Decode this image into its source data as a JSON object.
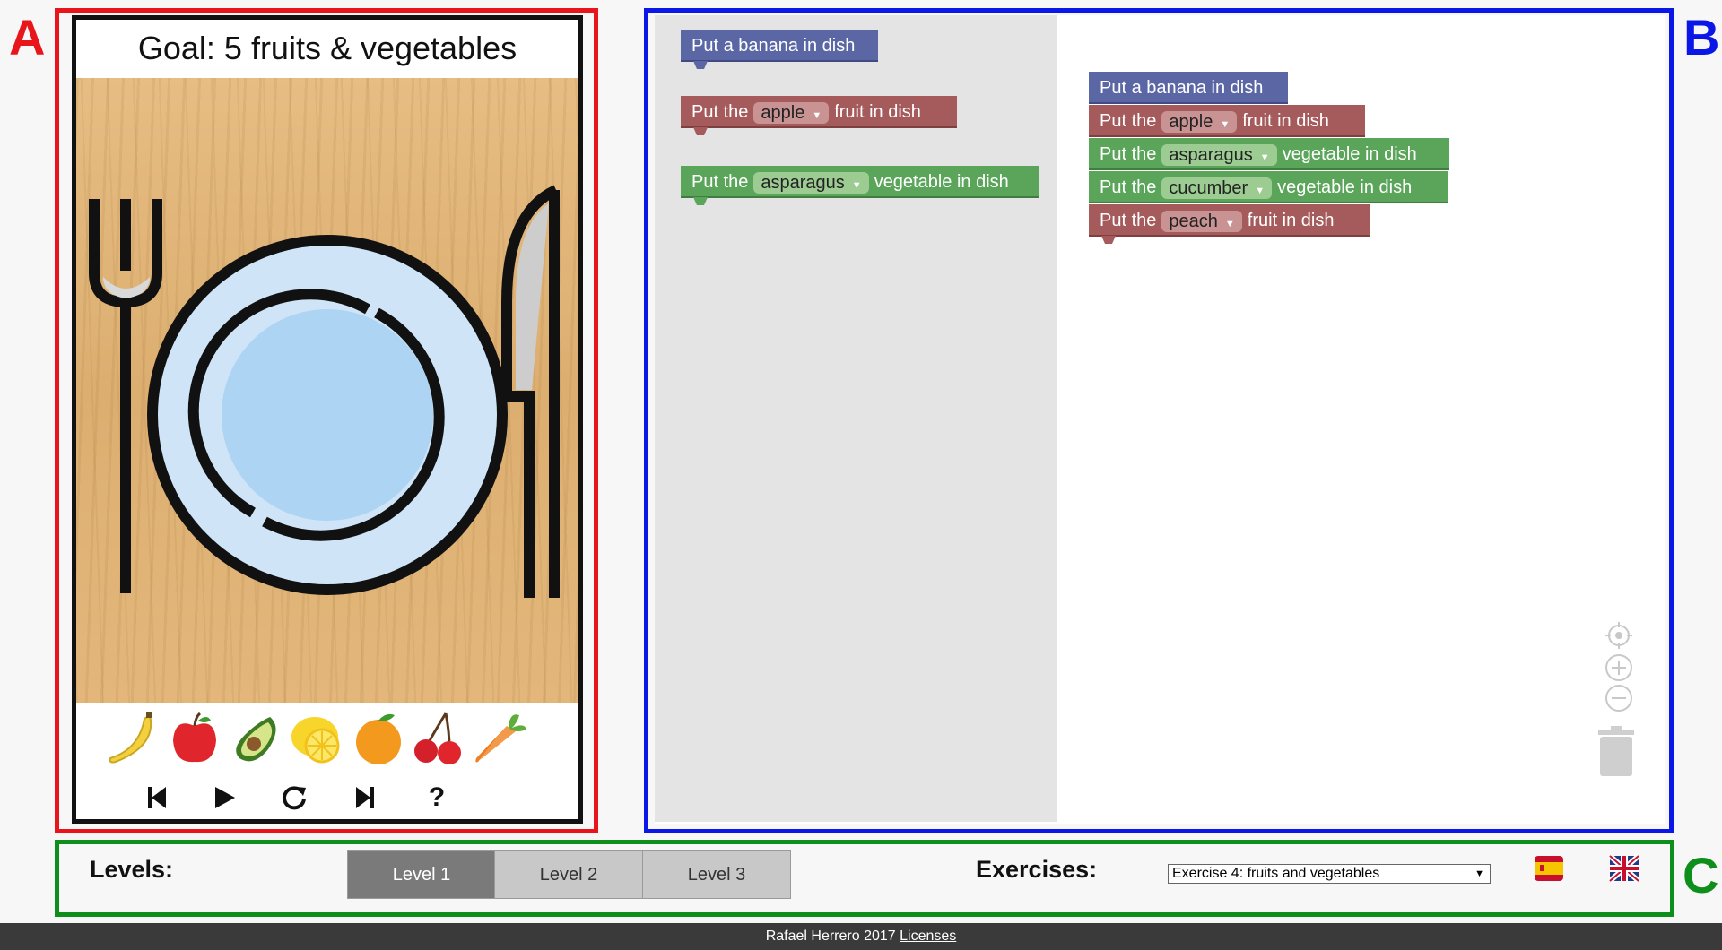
{
  "annotations": {
    "a": "A",
    "b": "B",
    "c": "C"
  },
  "game": {
    "goal": "Goal: 5 fruits & vegetables",
    "fruits": [
      "banana-icon",
      "apple-icon",
      "avocado-icon",
      "lemon-icon",
      "orange-icon",
      "cherry-icon",
      "carrot-icon"
    ],
    "controls": {
      "help": "?"
    }
  },
  "flyout": {
    "banana": "Put a banana in dish",
    "fruit": {
      "prefix": "Put the",
      "value": "apple",
      "suffix": "fruit in dish"
    },
    "vegetable": {
      "prefix": "Put the",
      "value": "asparagus",
      "suffix": "vegetable in dish"
    }
  },
  "program": {
    "b1": "Put a banana in dish",
    "b2": {
      "prefix": "Put the",
      "value": "apple",
      "suffix": "fruit in dish"
    },
    "b3": {
      "prefix": "Put the",
      "value": "asparagus",
      "suffix": "vegetable in dish"
    },
    "b4": {
      "prefix": "Put the",
      "value": "cucumber",
      "suffix": "vegetable in dish"
    },
    "b5": {
      "prefix": "Put the",
      "value": "peach",
      "suffix": "fruit in dish"
    }
  },
  "levels": {
    "label": "Levels:",
    "items": [
      "Level 1",
      "Level 2",
      "Level 3"
    ],
    "active": "Level 1"
  },
  "exercises": {
    "label": "Exercises:",
    "selected": "Exercise 4: fruits and vegetables"
  },
  "footer": {
    "text": "Rafael Herrero 2017",
    "link": "Licenses"
  },
  "colors": {
    "regionA": "#e8151b",
    "regionB": "#0a17e6",
    "regionC": "#0e8f1b",
    "blockBlue": "#5b67a5",
    "blockRed": "#a55b5b",
    "blockGreen": "#5ba55b"
  }
}
